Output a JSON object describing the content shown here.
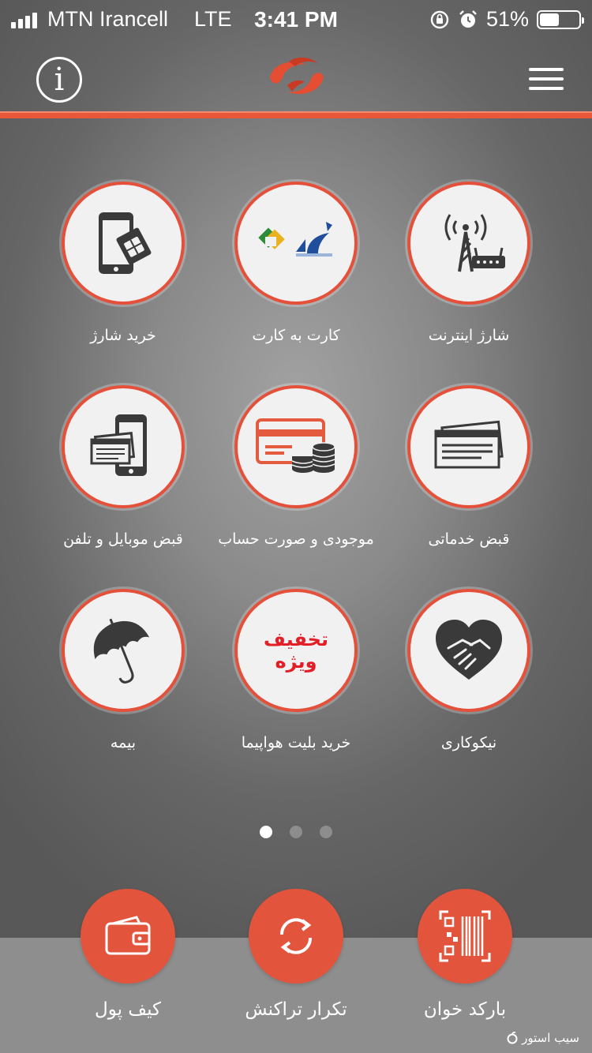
{
  "status_bar": {
    "carrier": "MTN Irancell",
    "network": "LTE",
    "time": "3:41 PM",
    "battery_text": "51%",
    "battery_level": 0.51
  },
  "nav": {
    "info_icon": "info-icon",
    "logo_icon": "app-logo",
    "menu_icon": "hamburger-menu-icon",
    "accent_color": "#e9573a"
  },
  "tiles": [
    {
      "label": "خرید شارژ",
      "icon": "phone-sim-icon"
    },
    {
      "label": "کارت به کارت",
      "icon": "bank-logos-icon"
    },
    {
      "label": "شارژ اینترنت",
      "icon": "antenna-router-icon"
    },
    {
      "label": "قبض موبایل و تلفن",
      "icon": "phone-bill-icon"
    },
    {
      "label": "موجودی و صورت حساب",
      "icon": "card-coins-icon"
    },
    {
      "label": "قبض خدماتی",
      "icon": "utility-bill-icon"
    },
    {
      "label": "بیمه",
      "icon": "umbrella-icon"
    },
    {
      "label": "خرید بلیت هواپیما",
      "icon": "discount-badge",
      "badge_line1": "تخفیف",
      "badge_line2": "ویژه"
    },
    {
      "label": "نیکوکاری",
      "icon": "heart-handshake-icon"
    }
  ],
  "pager": {
    "count": 3,
    "active": 0
  },
  "actions": [
    {
      "label": "کیف پول",
      "icon": "wallet-icon"
    },
    {
      "label": "تکرار تراکنش",
      "icon": "repeat-icon"
    },
    {
      "label": "بارکد خوان",
      "icon": "barcode-qr-icon"
    }
  ],
  "watermark": "سیب استور"
}
